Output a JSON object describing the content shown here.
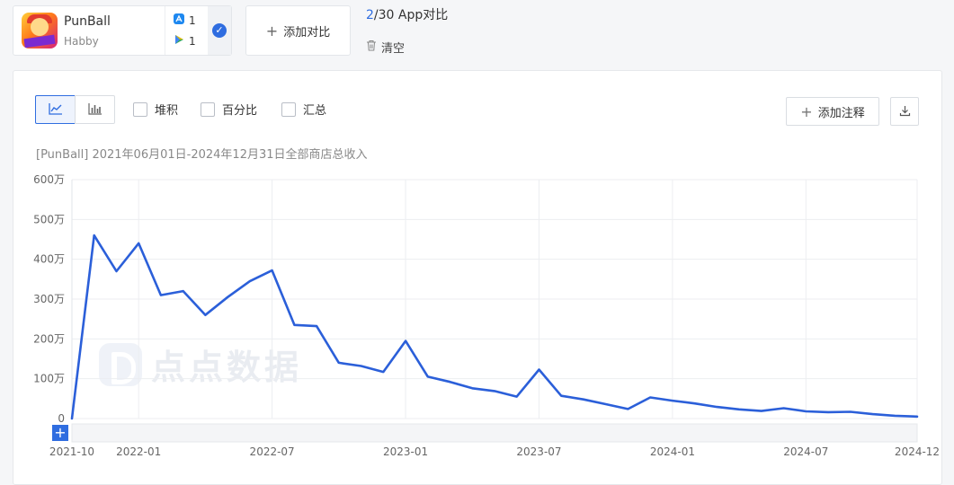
{
  "app": {
    "name": "PunBall",
    "developer": "Habby",
    "ios_count": "1",
    "gp_count": "1"
  },
  "compare": {
    "add_label": "添加对比",
    "count_current": "2",
    "count_rest": "/30 App对比",
    "clear_label": "清空"
  },
  "toolbar": {
    "stack_label": "堆积",
    "percent_label": "百分比",
    "sum_label": "汇总",
    "add_note_label": "添加注释"
  },
  "watermark_text": "点点数据",
  "colors": {
    "accent": "#2f6de0",
    "line": "#2b5fd9"
  },
  "chart_data": {
    "type": "line",
    "title": "[PunBall] 2021年06月01日-2024年12月31日全部商店总收入",
    "ylim": [
      0,
      6000000
    ],
    "y_tick_labels": [
      "0",
      "100万",
      "200万",
      "300万",
      "400万",
      "500万",
      "600万"
    ],
    "x_tick_labels": [
      "2021-10",
      "2022-01",
      "2022-07",
      "2023-01",
      "2023-07",
      "2024-01",
      "2024-07",
      "2024-12"
    ],
    "grid": true,
    "x": [
      "2021-10",
      "2021-11",
      "2021-12",
      "2022-01",
      "2022-02",
      "2022-03",
      "2022-04",
      "2022-05",
      "2022-06",
      "2022-07",
      "2022-08",
      "2022-09",
      "2022-10",
      "2022-11",
      "2022-12",
      "2023-01",
      "2023-02",
      "2023-03",
      "2023-04",
      "2023-05",
      "2023-06",
      "2023-07",
      "2023-08",
      "2023-09",
      "2023-10",
      "2023-11",
      "2023-12",
      "2024-01",
      "2024-02",
      "2024-03",
      "2024-04",
      "2024-05",
      "2024-06",
      "2024-07",
      "2024-08",
      "2024-09",
      "2024-10",
      "2024-11",
      "2024-12"
    ],
    "series": [
      {
        "values": [
          0,
          4600000,
          3700000,
          4400000,
          3100000,
          3200000,
          2600000,
          3050000,
          3450000,
          3720000,
          2350000,
          2320000,
          1400000,
          1320000,
          1170000,
          1950000,
          1050000,
          920000,
          760000,
          690000,
          550000,
          1230000,
          570000,
          480000,
          360000,
          240000,
          530000,
          450000,
          380000,
          290000,
          230000,
          190000,
          260000,
          180000,
          160000,
          170000,
          110000,
          70000,
          50000
        ]
      }
    ]
  }
}
